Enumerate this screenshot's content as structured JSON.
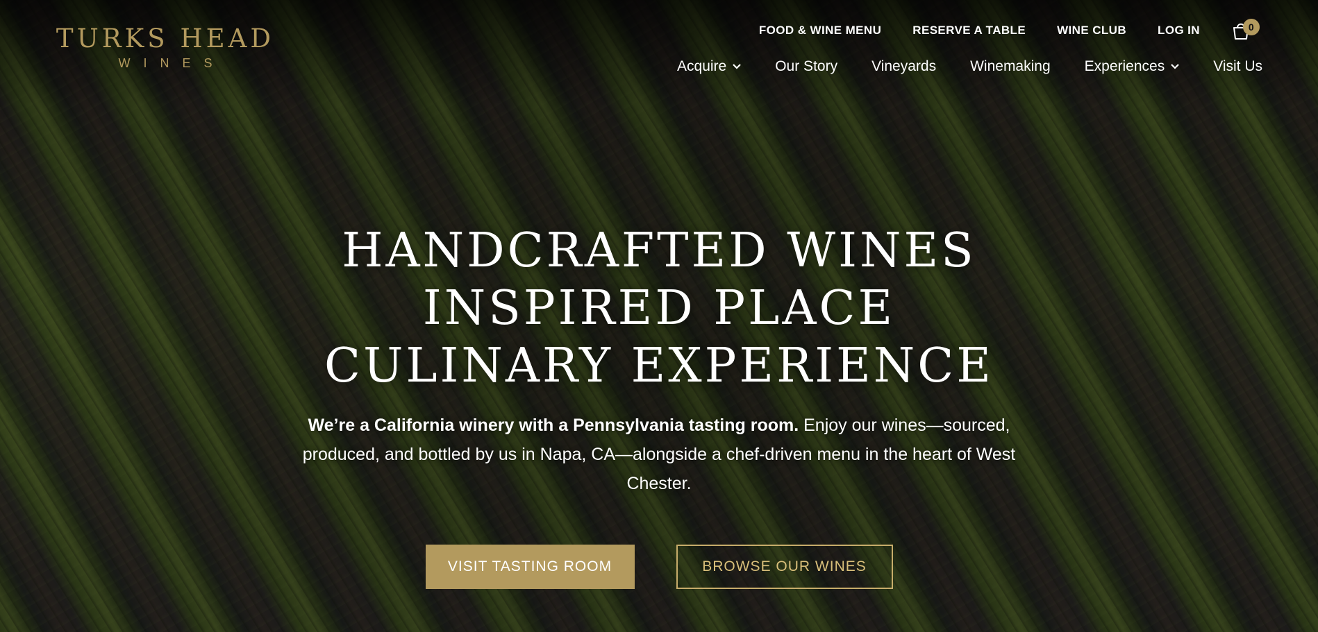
{
  "brand": {
    "name": "TURKS HEAD",
    "sub": "WINES",
    "accent_color": "#b39a5e"
  },
  "top_nav": {
    "items": [
      {
        "label": "FOOD & WINE MENU"
      },
      {
        "label": "RESERVE A TABLE"
      },
      {
        "label": "WINE CLUB"
      },
      {
        "label": "LOG IN"
      }
    ],
    "cart": {
      "icon": "shopping-bag-icon",
      "count": "0"
    }
  },
  "main_nav": {
    "items": [
      {
        "label": "Acquire",
        "dropdown": true
      },
      {
        "label": "Our Story",
        "dropdown": false
      },
      {
        "label": "Vineyards",
        "dropdown": false
      },
      {
        "label": "Winemaking",
        "dropdown": false
      },
      {
        "label": "Experiences",
        "dropdown": true
      },
      {
        "label": "Visit Us",
        "dropdown": false
      }
    ]
  },
  "hero": {
    "headline": [
      "HANDCRAFTED WINES",
      "INSPIRED PLACE",
      "CULINARY EXPERIENCE"
    ],
    "intro_bold": "We’re a California winery with a Pennsylvania tasting room.",
    "intro_rest": " Enjoy our wines—sourced, produced, and bottled by us in Napa, CA—alongside a chef-driven menu in the heart of West Chester.",
    "primary_cta": "VISIT TASTING ROOM",
    "secondary_cta": "BROWSE OUR WINES"
  }
}
